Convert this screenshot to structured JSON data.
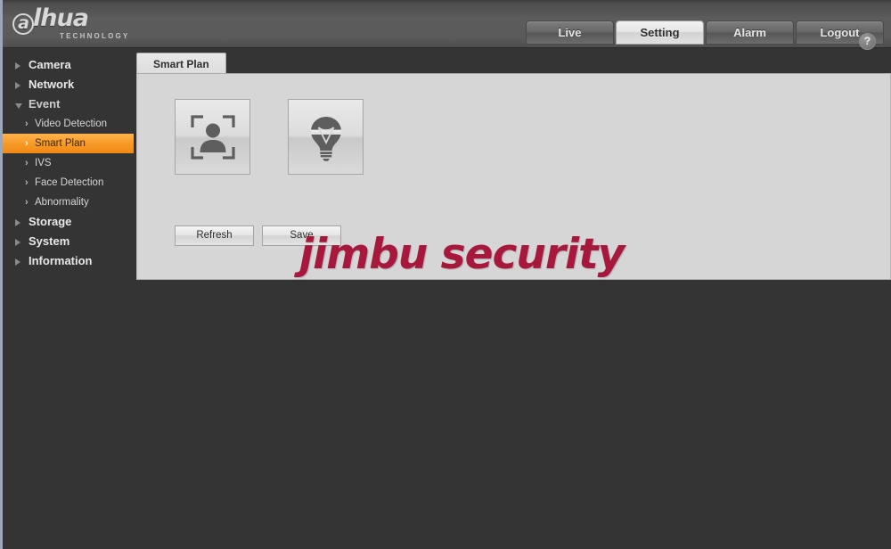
{
  "brand": {
    "logo_text": "alhua",
    "logo_initial": "a",
    "logo_rest": "lhua",
    "logo_sub": "TECHNOLOGY"
  },
  "topnav": {
    "items": [
      {
        "label": "Live",
        "active": false
      },
      {
        "label": "Setting",
        "active": true
      },
      {
        "label": "Alarm",
        "active": false
      },
      {
        "label": "Logout",
        "active": false
      }
    ]
  },
  "sidebar": {
    "groups": [
      {
        "label": "Camera",
        "expanded": false
      },
      {
        "label": "Network",
        "expanded": false
      },
      {
        "label": "Event",
        "expanded": true
      },
      {
        "label": "Storage",
        "expanded": false
      },
      {
        "label": "System",
        "expanded": false
      },
      {
        "label": "Information",
        "expanded": false
      }
    ],
    "event_items": [
      {
        "label": "Video Detection",
        "active": false
      },
      {
        "label": "Smart Plan",
        "active": true
      },
      {
        "label": "IVS",
        "active": false
      },
      {
        "label": "Face Detection",
        "active": false
      },
      {
        "label": "Abnormality",
        "active": false
      }
    ],
    "chevron": "›"
  },
  "content": {
    "tab_label": "Smart Plan",
    "help_label": "?",
    "plans": [
      {
        "name": "face-detection-plan",
        "icon": "person-in-frame-icon"
      },
      {
        "name": "ivs-plan",
        "icon": "lightbulb-icon"
      }
    ],
    "refresh_label": "Refresh",
    "save_label": "Save"
  },
  "watermark": {
    "text": "jimbu security",
    "color": "#a8183c"
  },
  "colors": {
    "accent_orange": "#f79a28",
    "header_gray": "#5a5a5a",
    "body_dark": "#333433",
    "panel_gray": "#d6d6d6",
    "left_border": "#9aa8bd"
  }
}
